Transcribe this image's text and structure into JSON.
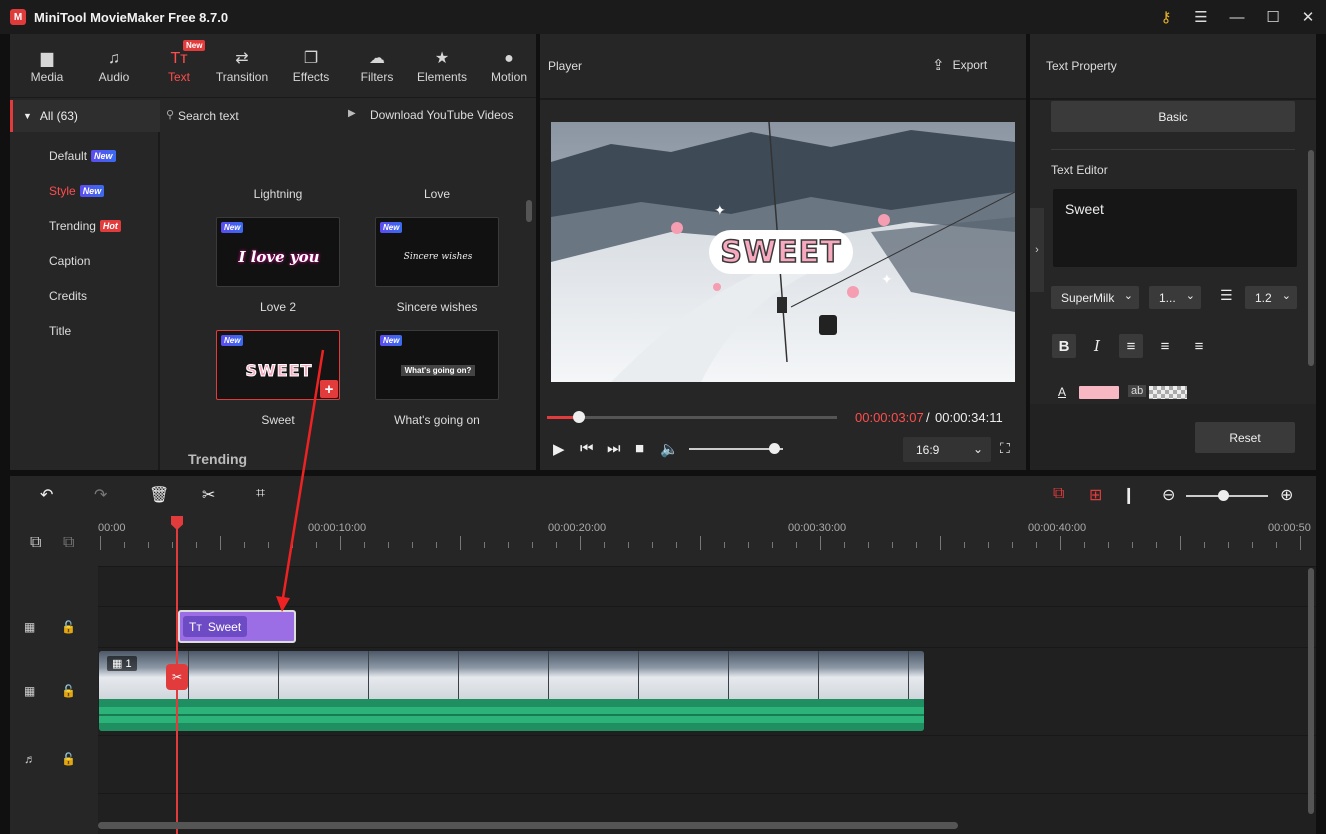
{
  "app": {
    "title": "MiniTool MovieMaker Free 8.7.0",
    "logo_letter": "M"
  },
  "window": {
    "key_icon": "⚷",
    "menu_icon": "☰",
    "minimize_icon": "—",
    "maximize_icon": "☐",
    "close_icon": "✕"
  },
  "tabs": [
    {
      "label": "Media",
      "icon": "▆"
    },
    {
      "label": "Audio",
      "icon": "♫"
    },
    {
      "label": "Text",
      "icon": "Tт",
      "badge": "New"
    },
    {
      "label": "Transition",
      "icon": "⇄"
    },
    {
      "label": "Effects",
      "icon": "❐"
    },
    {
      "label": "Filters",
      "icon": "☁"
    },
    {
      "label": "Elements",
      "icon": "★"
    },
    {
      "label": "Motion",
      "icon": "●"
    }
  ],
  "categories": {
    "all": "All (63)",
    "items": [
      {
        "label": "Default",
        "badge": "New"
      },
      {
        "label": "Style",
        "badge": "New"
      },
      {
        "label": "Trending",
        "badge": "Hot"
      },
      {
        "label": "Caption"
      },
      {
        "label": "Credits"
      },
      {
        "label": "Title"
      }
    ]
  },
  "library": {
    "search_placeholder": "Search text",
    "download_label": "Download YouTube Videos",
    "top_labels": [
      "Lightning",
      "Love"
    ],
    "items": [
      {
        "label": "Love 2",
        "badge": "New",
        "preview_text": "I love you"
      },
      {
        "label": "Sincere wishes",
        "badge": "New",
        "preview_text": "Sincere wishes"
      },
      {
        "label": "Sweet",
        "badge": "New",
        "preview_text": "SWEET"
      },
      {
        "label": "What's going on",
        "badge": "New",
        "preview_text": "What's going on?"
      }
    ],
    "section_heading": "Trending",
    "add_icon": "+"
  },
  "player": {
    "label": "Player",
    "export_label": "Export",
    "overlay_text": "SWEET",
    "current_time": "00:00:03:07",
    "separator": "/",
    "total_time": "00:00:34:11",
    "progress": 0.11,
    "volume": 0.9,
    "aspect_ratio": "16:9"
  },
  "properties": {
    "title": "Text Property",
    "basic_label": "Basic",
    "editor_label": "Text Editor",
    "editor_value": "Sweet",
    "font_name": "SuperMilk",
    "font_size": "1...",
    "line_spacing": "1.2",
    "text_color": "#f7b8c4",
    "color_letter": "A",
    "ab_label": "ab",
    "reset_label": "Reset"
  },
  "timeline": {
    "ruler": [
      "00:00",
      "00:00:10:00",
      "00:00:20:00",
      "00:00:30:00",
      "00:00:40:00",
      "00:00:50"
    ],
    "text_clip_label": "Sweet",
    "clip_badge": "1",
    "zoom": 0.45
  }
}
